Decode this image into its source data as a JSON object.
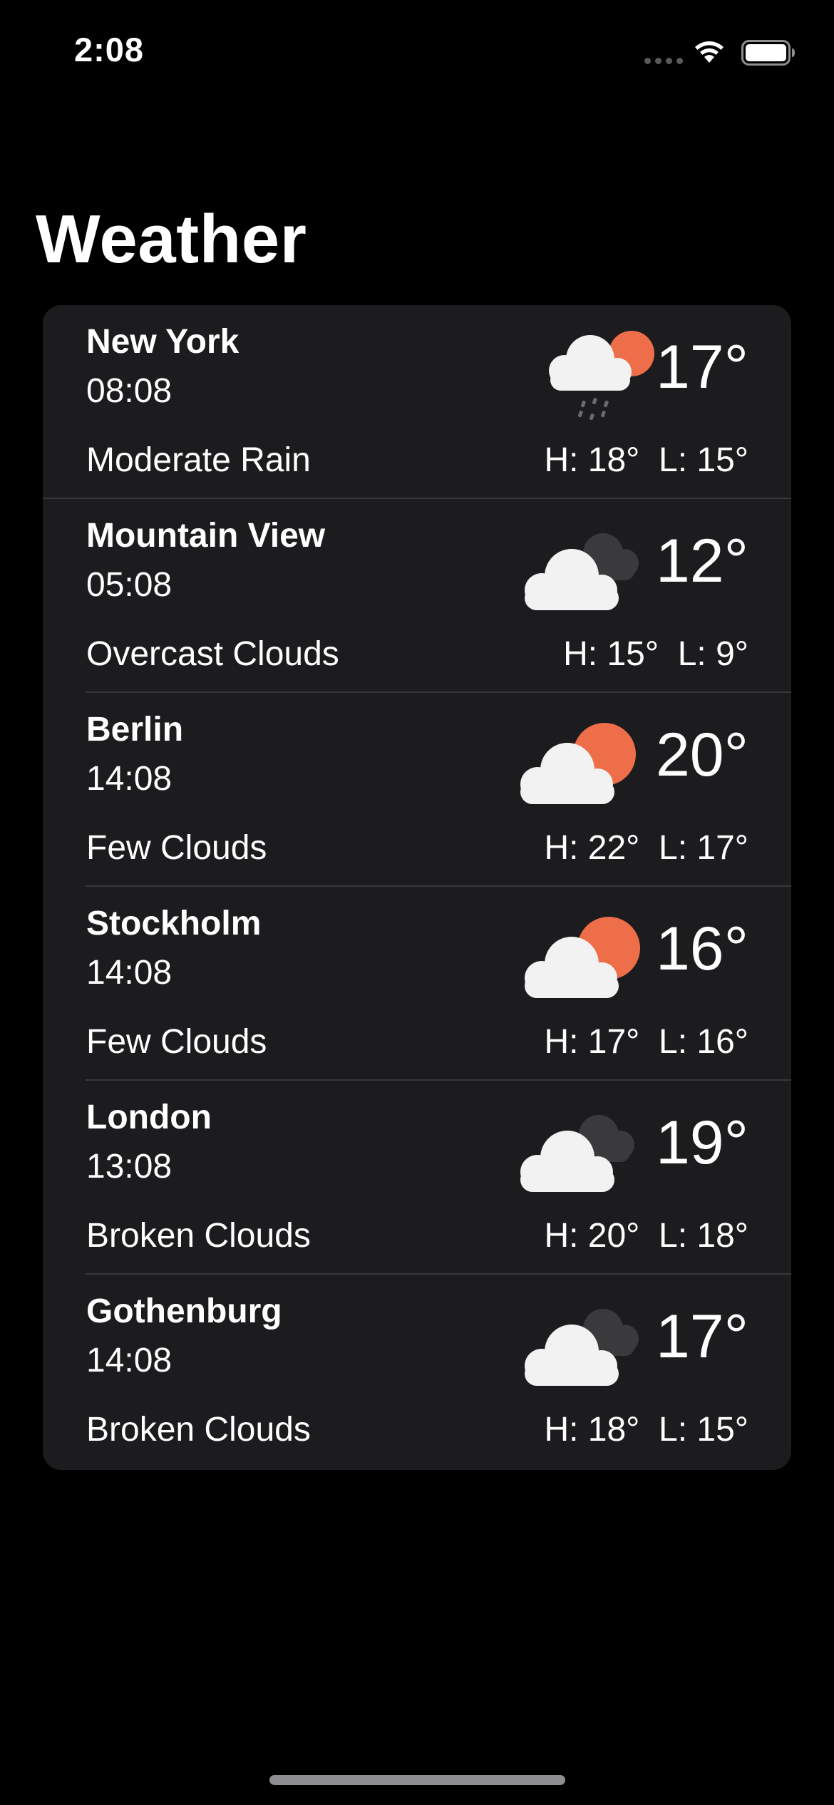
{
  "status_bar": {
    "time": "2:08",
    "wifi_icon": "wifi-icon",
    "battery_icon": "battery-icon"
  },
  "title": "Weather",
  "colors": {
    "background": "#000000",
    "card": "#1c1c1e",
    "divider": "#38383a",
    "sun": "#ee6e4a",
    "cloud_light": "#f2f2f2",
    "cloud_dark": "#3a3a3c"
  },
  "cities": [
    {
      "name": "New York",
      "time": "08:08",
      "description": "Moderate Rain",
      "temperature": "17°",
      "high_low": "H: 18°  L: 15°",
      "icon": "rain-sun-cloud-icon"
    },
    {
      "name": "Mountain View",
      "time": "05:08",
      "description": "Overcast Clouds",
      "temperature": "12°",
      "high_low": "H: 15°  L: 9°",
      "icon": "overcast-clouds-icon"
    },
    {
      "name": "Berlin",
      "time": "14:08",
      "description": "Few Clouds",
      "temperature": "20°",
      "high_low": "H: 22°  L: 17°",
      "icon": "few-clouds-icon"
    },
    {
      "name": "Stockholm",
      "time": "14:08",
      "description": "Few Clouds",
      "temperature": "16°",
      "high_low": "H: 17°  L: 16°",
      "icon": "few-clouds-icon"
    },
    {
      "name": "London",
      "time": "13:08",
      "description": "Broken Clouds",
      "temperature": "19°",
      "high_low": "H: 20°  L: 18°",
      "icon": "broken-clouds-icon"
    },
    {
      "name": "Gothenburg",
      "time": "14:08",
      "description": "Broken Clouds",
      "temperature": "17°",
      "high_low": "H: 18°  L: 15°",
      "icon": "broken-clouds-icon"
    }
  ]
}
